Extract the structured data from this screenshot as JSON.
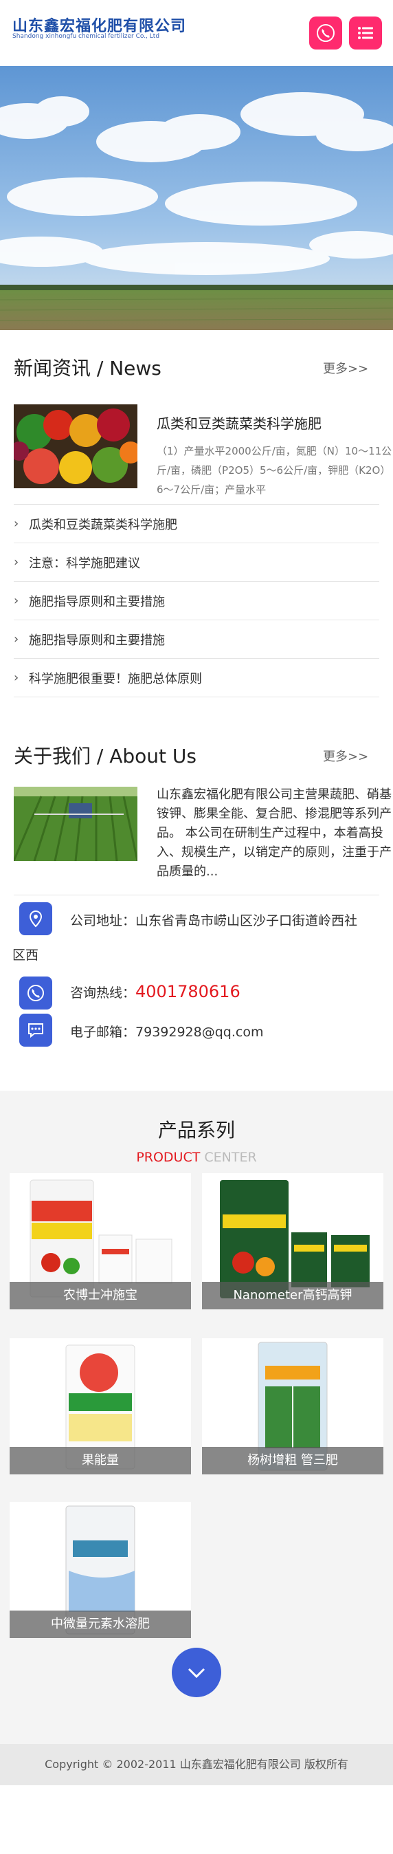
{
  "header": {
    "brand_cn": "山东鑫宏福化肥有限公司",
    "brand_en": "Shandong xinhongfu chemical fertilizer Co., Ltd",
    "phone_icon": "phone-icon",
    "menu_icon": "menu-icon",
    "accent_color": "#ff2a6e"
  },
  "news": {
    "title": "新闻资讯 / News",
    "more": "更多>>",
    "featured": {
      "title": "瓜类和豆类蔬菜类科学施肥",
      "excerpt": "（1）产量水平2000公斤/亩，氮肥（N）10～11公斤/亩，磷肥（P2O5）5～6公斤/亩，钾肥（K2O）6～7公斤/亩；产量水平"
    },
    "items": [
      "瓜类和豆类蔬菜类科学施肥",
      "注意：科学施肥建议",
      "施肥指导原则和主要措施",
      "施肥指导原则和主要措施",
      "科学施肥很重要！施肥总体原则"
    ]
  },
  "about": {
    "title": "关于我们 / About Us",
    "more": "更多>>",
    "text": "山东鑫宏福化肥有限公司主营果蔬肥、硝基铵钾、膨果全能、复合肥、掺混肥等系列产品。 本公司在研制生产过程中，本着高投入、规模生产，以销定产的原则，注重于产品质量的...",
    "address_label": "公司地址：",
    "address_line1": "山东省青岛市崂山区沙子口街道岭西社",
    "address_line2": "区西",
    "hotline_label": "咨询热线：",
    "hotline": "4001780616",
    "email_label": "电子邮箱：",
    "email": "79392928@qq.com",
    "icon_color": "#3d5fd8"
  },
  "products": {
    "title": "产品系列",
    "sub_red": "PRODUCT",
    "sub_grey": " CENTER",
    "items": [
      "农博士冲施宝",
      "Nanometer高钙高钾",
      "果能量",
      "杨树增粗 管三肥",
      "中微量元素水溶肥"
    ]
  },
  "footer": {
    "copyright": "Copyright © 2002-2011 山东鑫宏福化肥有限公司 版权所有"
  }
}
